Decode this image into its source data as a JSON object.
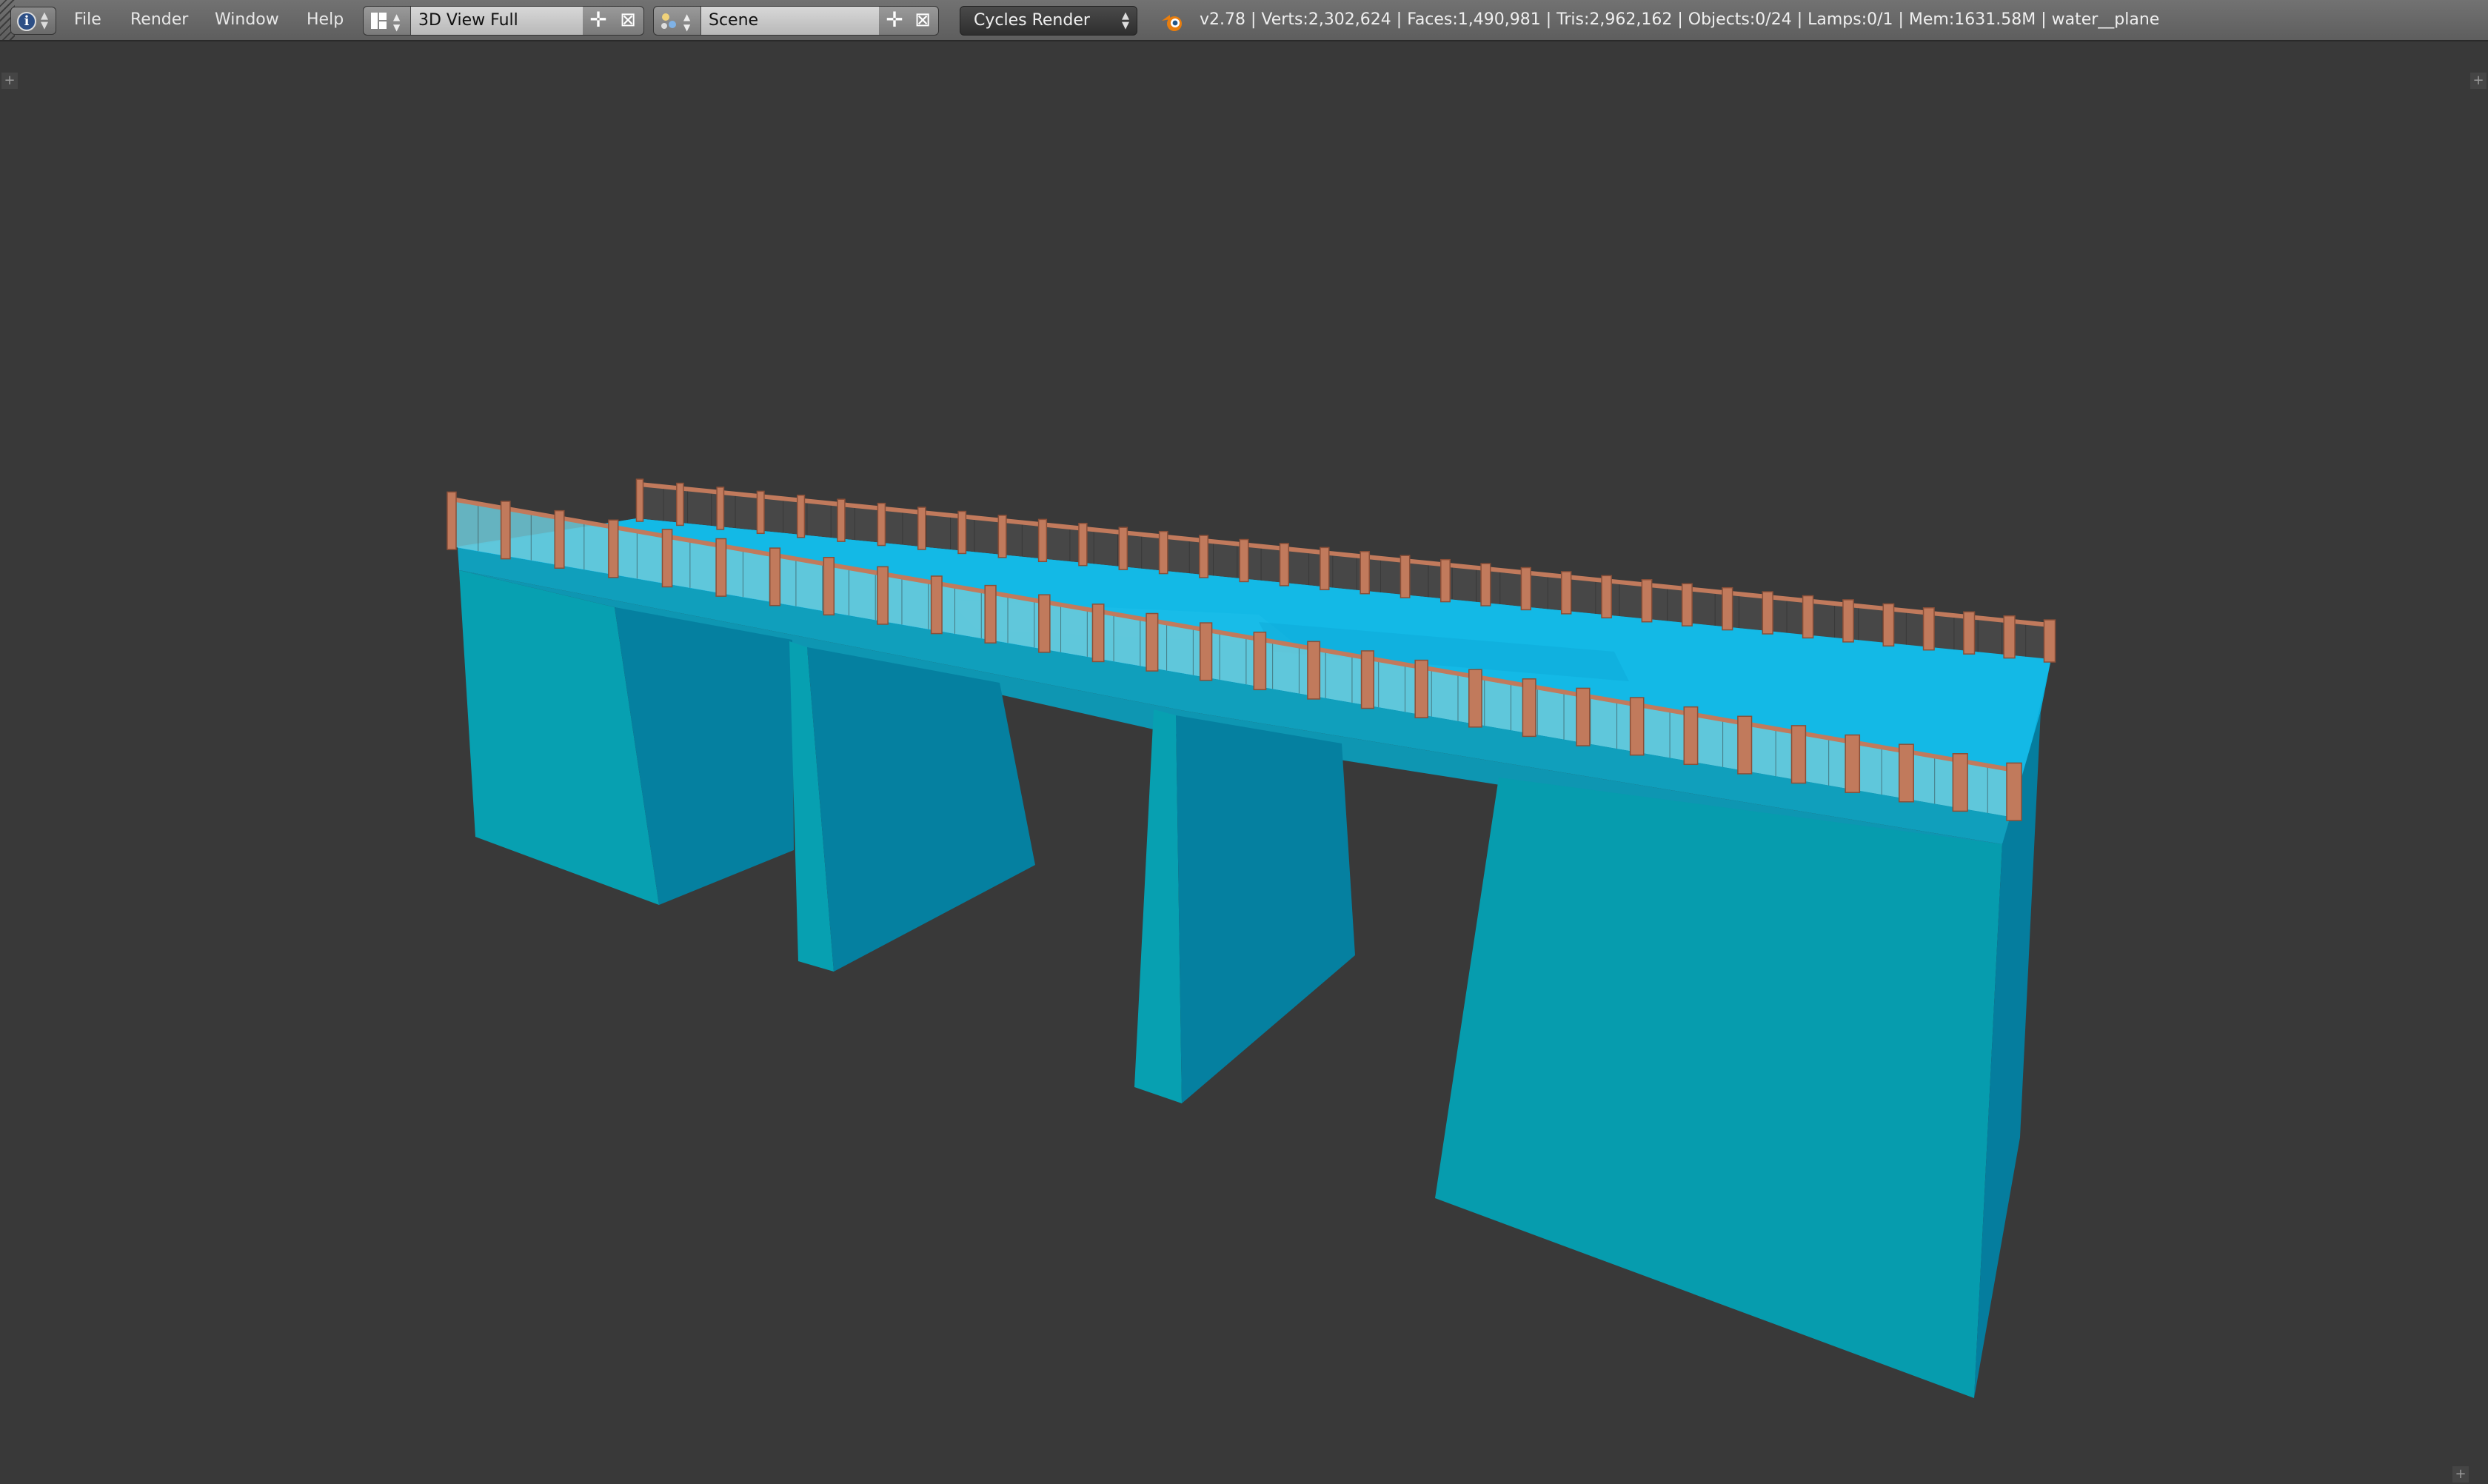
{
  "header": {
    "editor_type_icon": "info-icon",
    "menu": [
      "File",
      "Render",
      "Window",
      "Help"
    ],
    "screen_layout": {
      "icon": "layout-icon",
      "value": "3D View Full"
    },
    "scene": {
      "icon": "scene-icon",
      "value": "Scene"
    },
    "add_icon": "plus-icon",
    "remove_icon": "x-icon",
    "render_engine": "Cycles Render",
    "logo_icon": "blender-logo-icon",
    "stats": "v2.78 | Verts:2,302,624 | Faces:1,490,981 | Tris:2,962,162 | Objects:0/24 | Lamps:0/1 | Mem:1631.58M | water__plane"
  },
  "viewport": {
    "background": "#393939",
    "model": "bridge",
    "colors": {
      "deck_top": "#10b4df",
      "deck_side": "#0fa4bf",
      "pier_front": "#079fb0",
      "pier_side": "#057d9e",
      "railing_post": "#c17a5c",
      "railing_mesh_near": "#6dc9d8",
      "railing_mesh_far": "#4a4a4a"
    }
  }
}
